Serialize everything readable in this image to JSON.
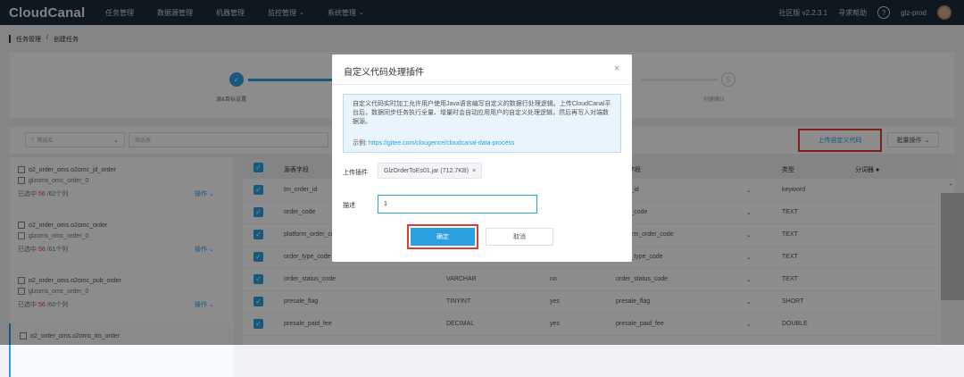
{
  "app": {
    "logo": "CloudCanal"
  },
  "nav": {
    "items": [
      {
        "label": "任务管理",
        "dropdown": false
      },
      {
        "label": "数据源管理",
        "dropdown": false
      },
      {
        "label": "机器管理",
        "dropdown": false
      },
      {
        "label": "监控管理",
        "dropdown": true
      },
      {
        "label": "系统管理",
        "dropdown": true
      }
    ],
    "version": "社区版 v2.2.3.1",
    "help_link": "寻求帮助",
    "help_icon": "?",
    "user": "glz-prod"
  },
  "breadcrumb": {
    "parent": "任务管理",
    "separator": "/",
    "current": "创建任务"
  },
  "steps": {
    "step1_label": "源&目标设置",
    "step_todo_number": "5",
    "step5_label": "创建确认",
    "check_icon": "✓"
  },
  "filter": {
    "select_placeholder": "筛选库",
    "search_placeholder": "筛选表",
    "upload_code_label": "上传自定义代码",
    "batch_label": "批量操作",
    "chevron": "⌄"
  },
  "left_tables": [
    {
      "table": "o2_order_oms.o2omc_jd_order",
      "target": "glzoms_omc_order_0",
      "selected_prefix": "已选中",
      "selected_count": "56",
      "selected_suffix": "/62个列",
      "op": "操作"
    },
    {
      "table": "o2_order_oms.o2omc_order",
      "target": "glzoms_omc_order_0",
      "selected_prefix": "已选中",
      "selected_count": "56",
      "selected_suffix": "/61个列",
      "op": "操作"
    },
    {
      "table": "o2_order_oms.o2omc_pub_order",
      "target": "glzoms_omc_order_0",
      "selected_prefix": "已选中",
      "selected_count": "56",
      "selected_suffix": "/60个列",
      "op": "操作"
    },
    {
      "table": "o2_order_oms.o2omc_tm_order",
      "target": "",
      "selected_prefix": "",
      "selected_count": "",
      "selected_suffix": "",
      "op": ""
    }
  ],
  "table": {
    "headers": {
      "source_field": "源表字段",
      "index_field": "索引字段",
      "type": "类型",
      "partition_key": "分词器"
    },
    "rows": [
      {
        "source": "tm_order_id",
        "src_type": "",
        "nullable": "",
        "index": "order_id",
        "type": "keyword"
      },
      {
        "source": "order_code",
        "src_type": "",
        "nullable": "",
        "index": "order_code",
        "type": "TEXT"
      },
      {
        "source": "platform_order_code",
        "src_type": "",
        "nullable": "",
        "index": "platform_order_code",
        "type": "TEXT"
      },
      {
        "source": "order_type_code",
        "src_type": "",
        "nullable": "",
        "index": "order_type_code",
        "type": "TEXT"
      },
      {
        "source": "order_status_code",
        "src_type": "VARCHAR",
        "nullable": "no",
        "index": "order_status_code",
        "type": "TEXT"
      },
      {
        "source": "presale_flag",
        "src_type": "TINYINT",
        "nullable": "yes",
        "index": "presale_flag",
        "type": "SHORT"
      },
      {
        "source": "presale_paid_fee",
        "src_type": "DECIMAL",
        "nullable": "yes",
        "index": "presale_paid_fee",
        "type": "DOUBLE"
      }
    ]
  },
  "modal": {
    "title": "自定义代码处理插件",
    "close": "×",
    "info_text": "自定义代码实时加工允许用户使用Java语言编写自定义的数据行处理逻辑。上传CloudCanal平台后，数据同步任务执行全量、增量时会自动应用用户的自定义处理逻辑，然后再写入对端数据源。",
    "example_label": "示例:",
    "example_link": "https://gitee.com/clougence/cloudcanal-data-process",
    "upload_label": "上传插件",
    "file_name": "GlzOrderToEs01.jar (712.7KB)",
    "file_remove": "×",
    "desc_label": "描述",
    "desc_value": "1",
    "ok_label": "确定",
    "cancel_label": "取消"
  },
  "colors": {
    "primary": "#2aa0e0",
    "highlight": "#e33b2f",
    "nav_bg": "#1c2b3a"
  }
}
